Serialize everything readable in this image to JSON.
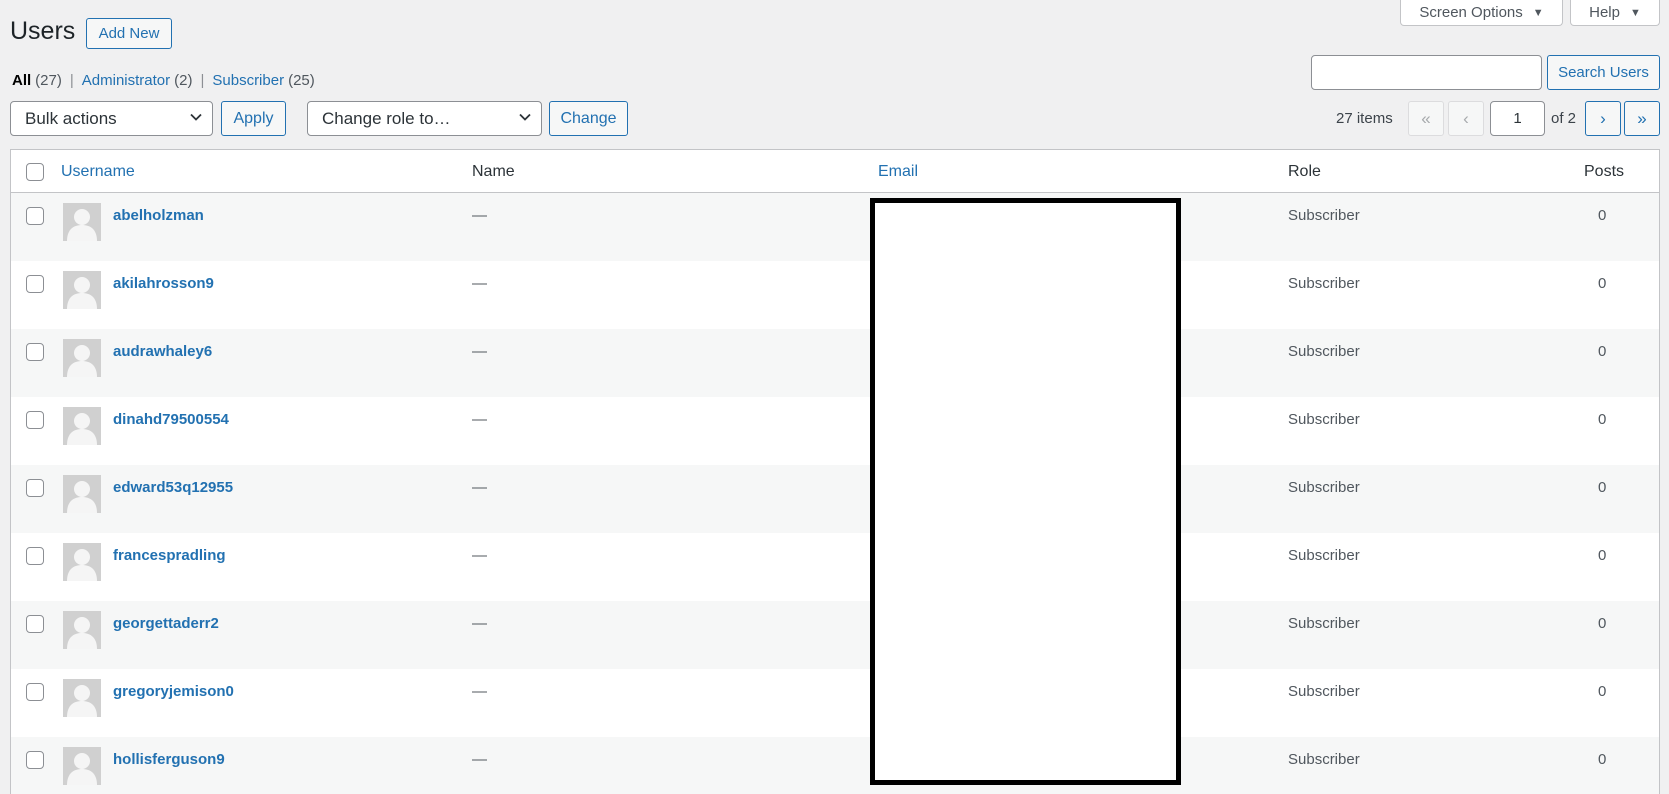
{
  "header": {
    "screen_options_label": "Screen Options",
    "help_label": "Help",
    "title": "Users",
    "add_new_label": "Add New"
  },
  "filters": [
    {
      "label": "All",
      "count": "(27)",
      "current": true
    },
    {
      "label": "Administrator",
      "count": "(2)",
      "current": false
    },
    {
      "label": "Subscriber",
      "count": "(25)",
      "current": false
    }
  ],
  "search": {
    "value": "",
    "button_label": "Search Users"
  },
  "actions": {
    "bulk_selected": "Bulk actions",
    "apply_label": "Apply",
    "role_selected": "Change role to…",
    "change_label": "Change"
  },
  "pagination": {
    "items_text": "27 items",
    "first": "«",
    "prev": "‹",
    "current_page": "1",
    "of_text": "of 2",
    "next": "›",
    "last": "»"
  },
  "table": {
    "columns": {
      "username": "Username",
      "name": "Name",
      "email": "Email",
      "role": "Role",
      "posts": "Posts"
    },
    "rows": [
      {
        "username": "abelholzman",
        "name": "—",
        "role": "Subscriber",
        "posts": "0"
      },
      {
        "username": "akilahrosson9",
        "name": "—",
        "role": "Subscriber",
        "posts": "0"
      },
      {
        "username": "audrawhaley6",
        "name": "—",
        "role": "Subscriber",
        "posts": "0"
      },
      {
        "username": "dinahd79500554",
        "name": "—",
        "role": "Subscriber",
        "posts": "0"
      },
      {
        "username": "edward53q12955",
        "name": "—",
        "role": "Subscriber",
        "posts": "0"
      },
      {
        "username": "francespradling",
        "name": "—",
        "role": "Subscriber",
        "posts": "0"
      },
      {
        "username": "georgettaderr2",
        "name": "—",
        "role": "Subscriber",
        "posts": "0"
      },
      {
        "username": "gregoryjemison0",
        "name": "—",
        "role": "Subscriber",
        "posts": "0"
      },
      {
        "username": "hollisferguson9",
        "name": "—",
        "role": "Subscriber",
        "posts": "0"
      }
    ]
  },
  "colors": {
    "link": "#2271b1",
    "background": "#f0f0f1",
    "alt_row": "#f6f7f7"
  }
}
